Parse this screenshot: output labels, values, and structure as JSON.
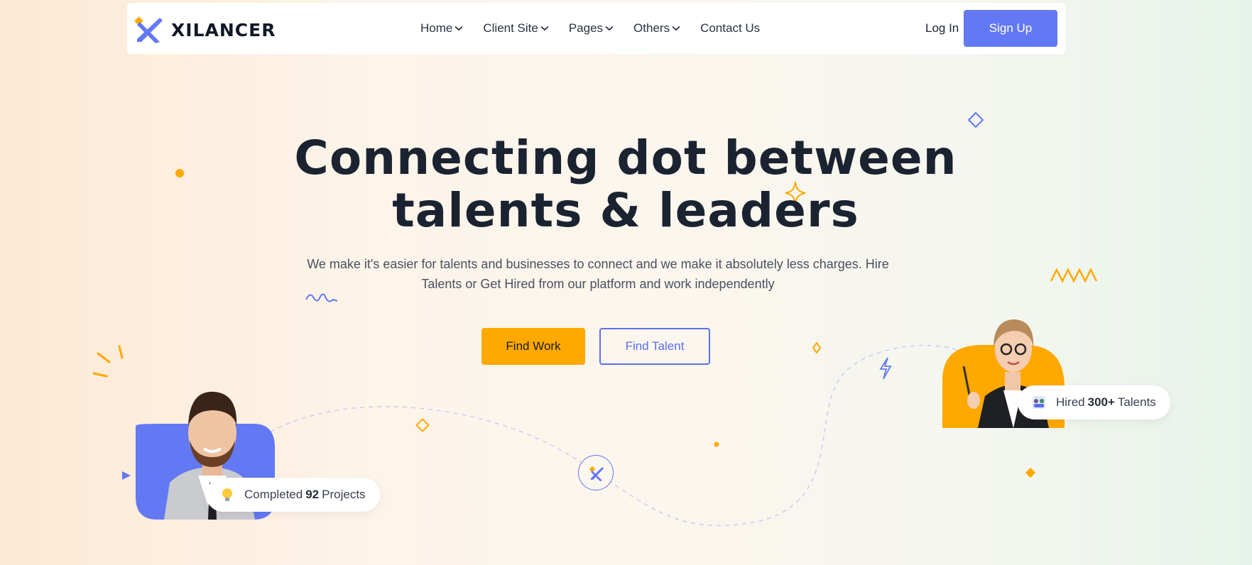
{
  "brand": {
    "name": "XILANCER"
  },
  "nav": {
    "items": [
      {
        "label": "Home",
        "has_dropdown": true
      },
      {
        "label": "Client Site",
        "has_dropdown": true
      },
      {
        "label": "Pages",
        "has_dropdown": true
      },
      {
        "label": "Others",
        "has_dropdown": true
      },
      {
        "label": "Contact Us",
        "has_dropdown": false
      }
    ],
    "login_label": "Log In",
    "signup_label": "Sign Up"
  },
  "hero": {
    "title_line1": "Connecting dot between",
    "title_line2": "talents & leaders",
    "subtitle_line1": "We make it's easier for talents and businesses to connect and we make it absolutely less charges. Hire",
    "subtitle_line2": "Talents or Get Hired from our platform and work independently",
    "find_work_label": "Find Work",
    "find_talent_label": "Find Talent"
  },
  "badges": {
    "left": {
      "prefix": "Completed",
      "value": "92",
      "suffix": "Projects",
      "icon": "lightbulb-icon"
    },
    "right": {
      "prefix": "Hired",
      "value": "300+",
      "suffix": "Talents",
      "icon": "people-group-icon"
    }
  },
  "colors": {
    "primary": "#6378f3",
    "accent": "#ffa800",
    "heading": "#1b2331"
  }
}
